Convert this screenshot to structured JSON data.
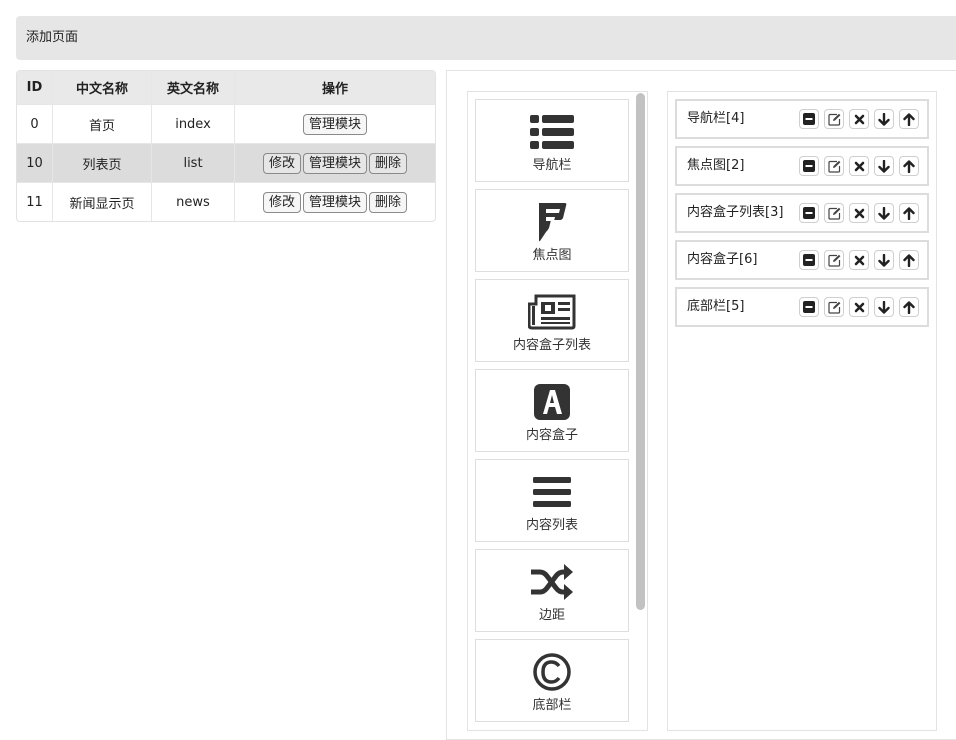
{
  "toolbar": {
    "add_page_label": "添加页面"
  },
  "table": {
    "headers": [
      "ID",
      "中文名称",
      "英文名称",
      "操作"
    ],
    "rows": [
      {
        "id": "0",
        "cn": "首页",
        "en": "index",
        "manage": "管理模块"
      },
      {
        "id": "10",
        "cn": "列表页",
        "en": "list",
        "edit": "修改",
        "manage": "管理模块",
        "delete": "删除"
      },
      {
        "id": "11",
        "cn": "新闻显示页",
        "en": "news",
        "edit": "修改",
        "manage": "管理模块",
        "delete": "删除"
      }
    ]
  },
  "palette": {
    "items": [
      {
        "label": "导航栏",
        "icon": "list-icon"
      },
      {
        "label": "焦点图",
        "icon": "foursquare-icon"
      },
      {
        "label": "内容盒子列表",
        "icon": "newspaper-icon"
      },
      {
        "label": "内容盒子",
        "icon": "font-a-icon"
      },
      {
        "label": "内容列表",
        "icon": "bars-icon"
      },
      {
        "label": "边距",
        "icon": "random-icon"
      },
      {
        "label": "底部栏",
        "icon": "copyright-icon"
      }
    ]
  },
  "modules": {
    "items": [
      {
        "label": "导航栏[4]"
      },
      {
        "label": "焦点图[2]"
      },
      {
        "label": "内容盒子列表[3]"
      },
      {
        "label": "内容盒子[6]"
      },
      {
        "label": "底部栏[5]"
      }
    ],
    "actions": [
      "minus-icon",
      "edit-icon",
      "remove-icon",
      "arrow-down-icon",
      "arrow-up-icon"
    ]
  },
  "colors": {
    "icon": "#333333",
    "highlight_row": "#dcdcdc",
    "topbar": "#e6e6e6"
  }
}
